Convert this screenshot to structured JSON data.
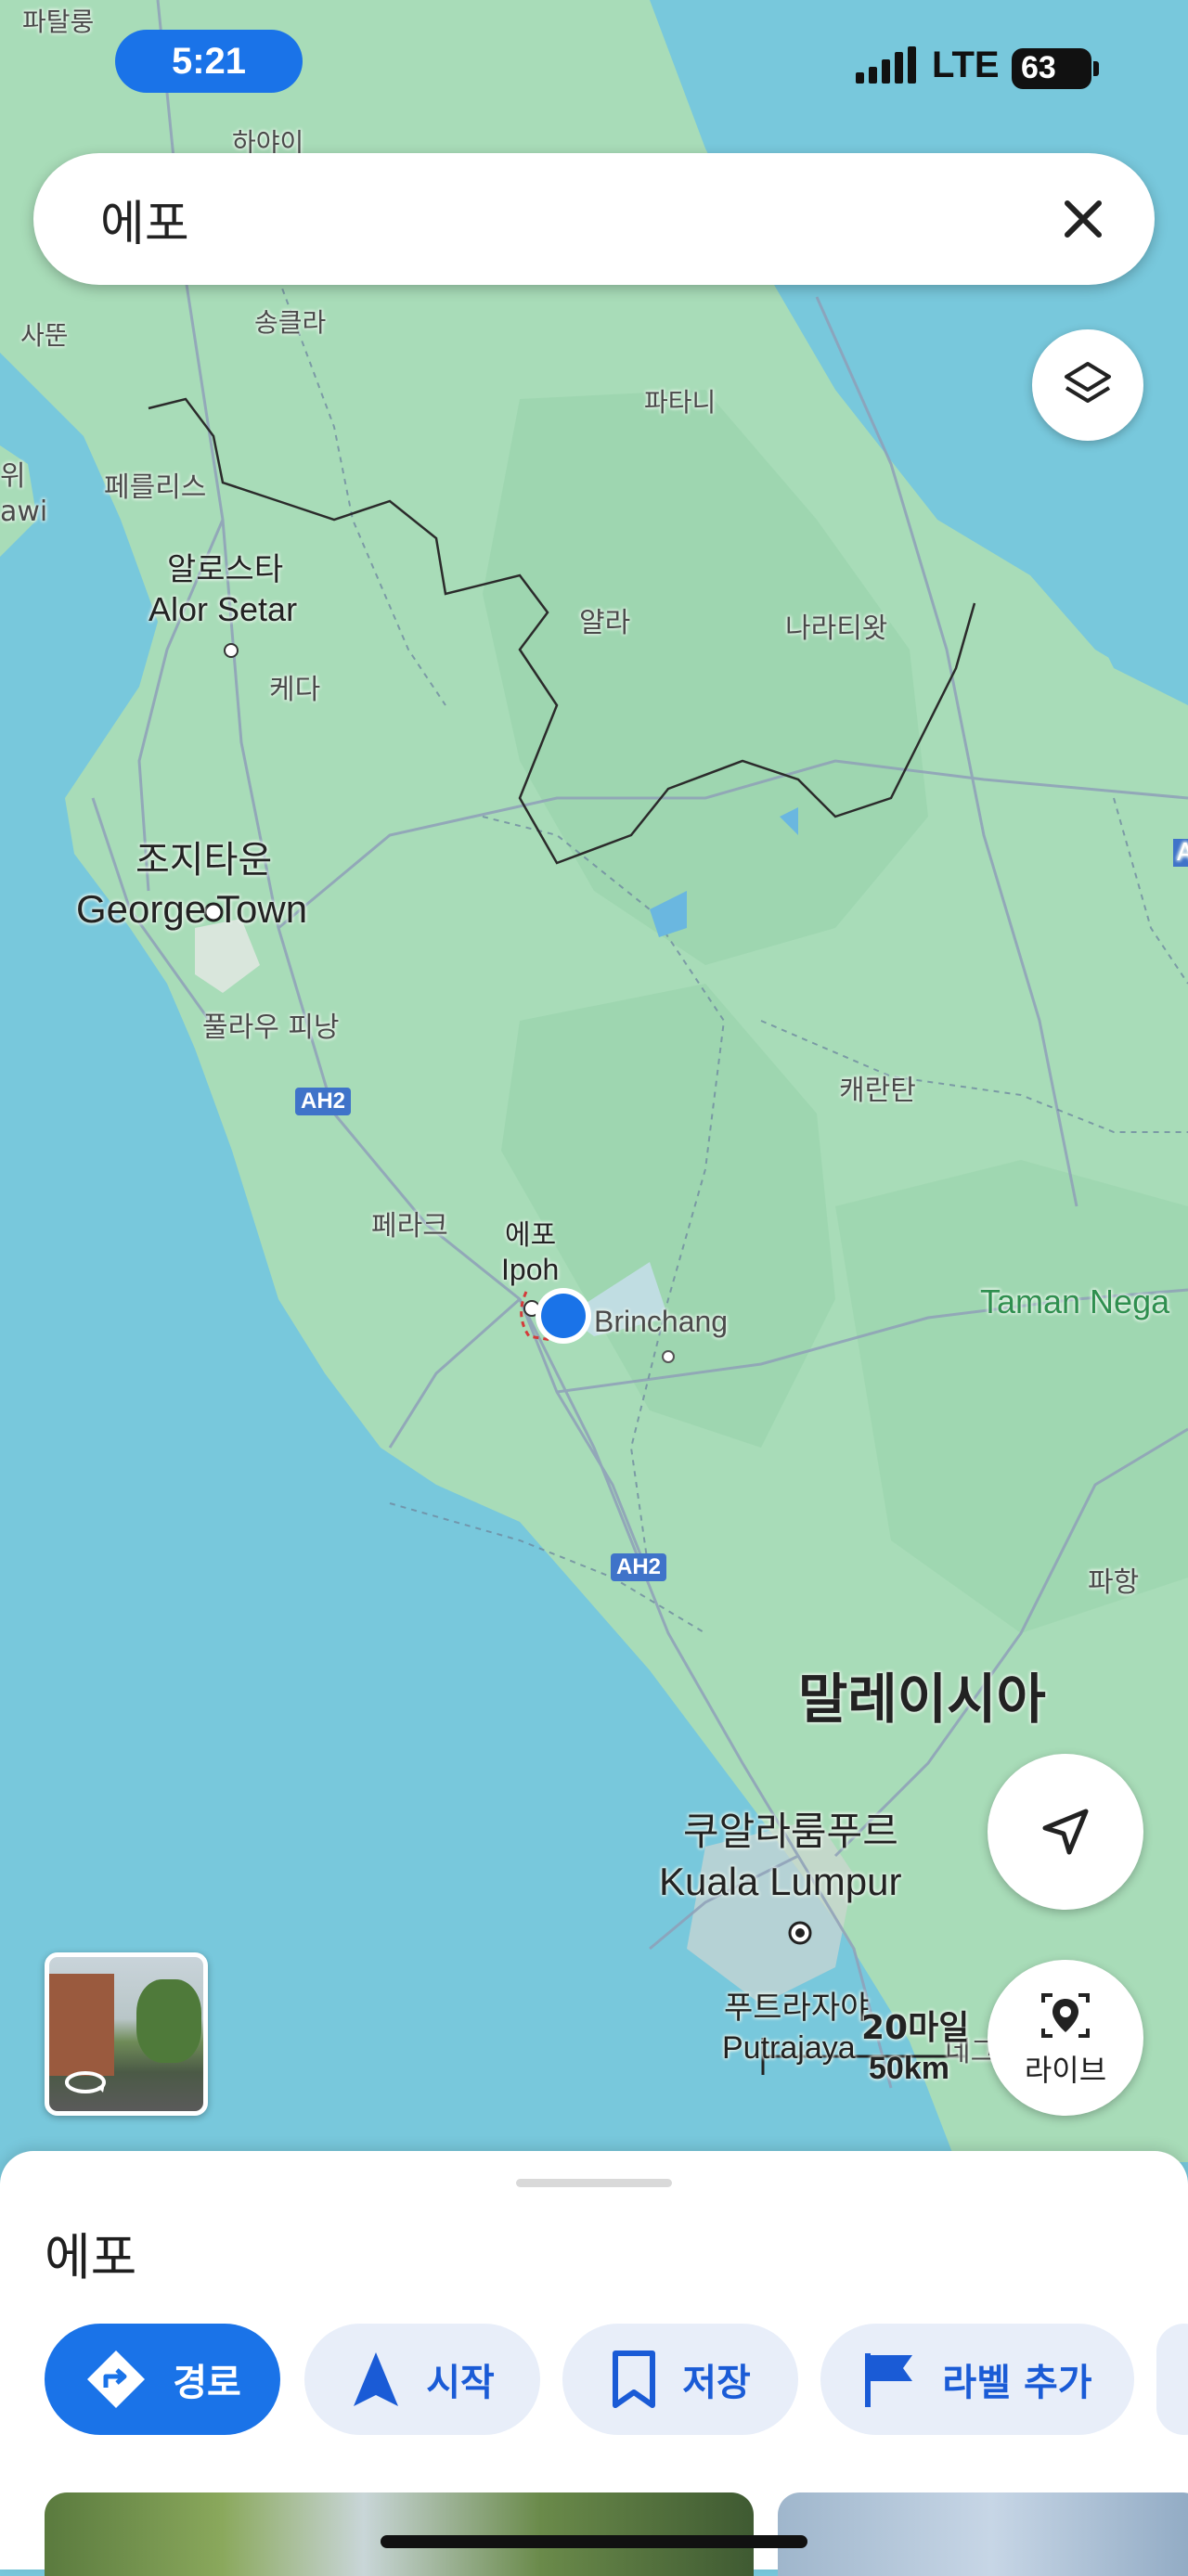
{
  "status_bar": {
    "time": "5:21",
    "network": "LTE",
    "battery": "63"
  },
  "search": {
    "query": "에포"
  },
  "map": {
    "labels": {
      "pattalung": "파탈룽",
      "hatyai": "하야이",
      "songkhla": "송클라",
      "satun": "사뚠",
      "pattani": "파타니",
      "perlis": "페를리스",
      "wi": "위",
      "awi": "awi",
      "alor_setar_ko": "알로스타",
      "alor_setar_en": "Alor Setar",
      "yala": "얄라",
      "narathiwat": "나라티왓",
      "kedah": "케다",
      "george_town_ko": "조지타운",
      "george_town_en": "George Town",
      "pulau_pinang": "풀라우 피낭",
      "ah2_north": "AH2",
      "kelantan": "캐란탄",
      "perak": "페라크",
      "ipoh_ko": "에포",
      "ipoh_en": "Ipoh",
      "brinchang": "Brinchang",
      "taman_negara": "Taman Nega",
      "ah2_south": "AH2",
      "pahang": "파항",
      "malaysia": "말레이시아",
      "kuala_lumpur_ko": "쿠알라룸푸르",
      "kuala_lumpur_en": "Kuala Lumpur",
      "putrajaya_ko": "푸트라자야",
      "putrajaya_en": "Putrajaya",
      "edge_a": "A",
      "negeri": "네그"
    },
    "scale": {
      "miles": "20마일",
      "km": "50km"
    }
  },
  "buttons": {
    "live_label": "라이브"
  },
  "sheet": {
    "title": "에포",
    "actions": [
      {
        "label": "경로"
      },
      {
        "label": "시작"
      },
      {
        "label": "저장"
      },
      {
        "label": "라벨 추가"
      }
    ]
  },
  "colors": {
    "accent": "#1a73e8",
    "land": "#a8dcb8",
    "water": "#78c8dc"
  }
}
